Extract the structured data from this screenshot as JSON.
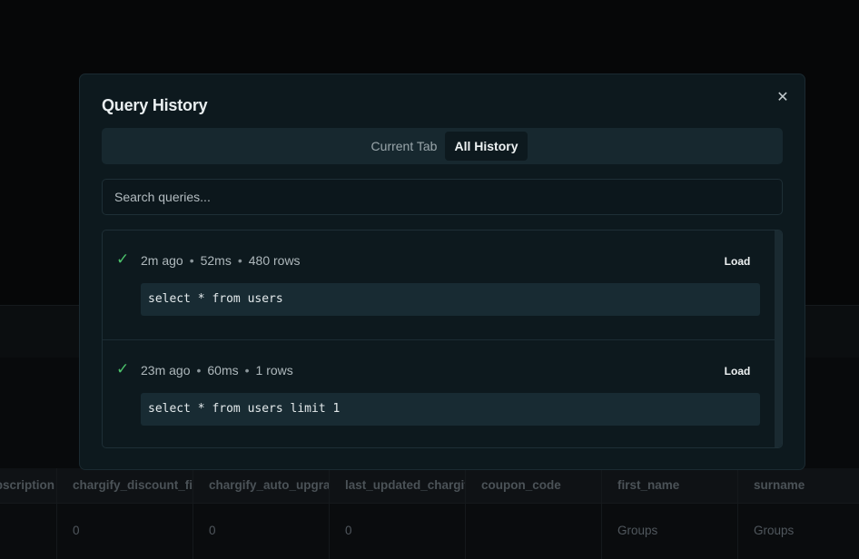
{
  "modal": {
    "title": "Query History",
    "close_icon": "close-icon",
    "tabs": [
      {
        "label": "Current Tab",
        "active": false
      },
      {
        "label": "All History",
        "active": true
      }
    ],
    "search": {
      "placeholder": "Search queries...",
      "value": ""
    },
    "history": [
      {
        "status_icon": "check-icon",
        "time": "2m ago",
        "duration": "52ms",
        "rows": "480 rows",
        "load_label": "Load",
        "query": "select * from users"
      },
      {
        "status_icon": "check-icon",
        "time": "23m ago",
        "duration": "60ms",
        "rows": "1 rows",
        "load_label": "Load",
        "query": "select * from users limit 1"
      }
    ]
  },
  "background_table": {
    "columns": [
      "bscription",
      "chargify_discount_fift",
      "chargify_auto_upgrac",
      "last_updated_chargify",
      "coupon_code",
      "first_name",
      "surname"
    ],
    "row": [
      "",
      "0",
      "0",
      "0",
      "",
      "Groups",
      "Groups"
    ]
  },
  "colors": {
    "modal_bg": "#0d191e",
    "success": "#4cc26b",
    "code_bg": "#182b33"
  }
}
